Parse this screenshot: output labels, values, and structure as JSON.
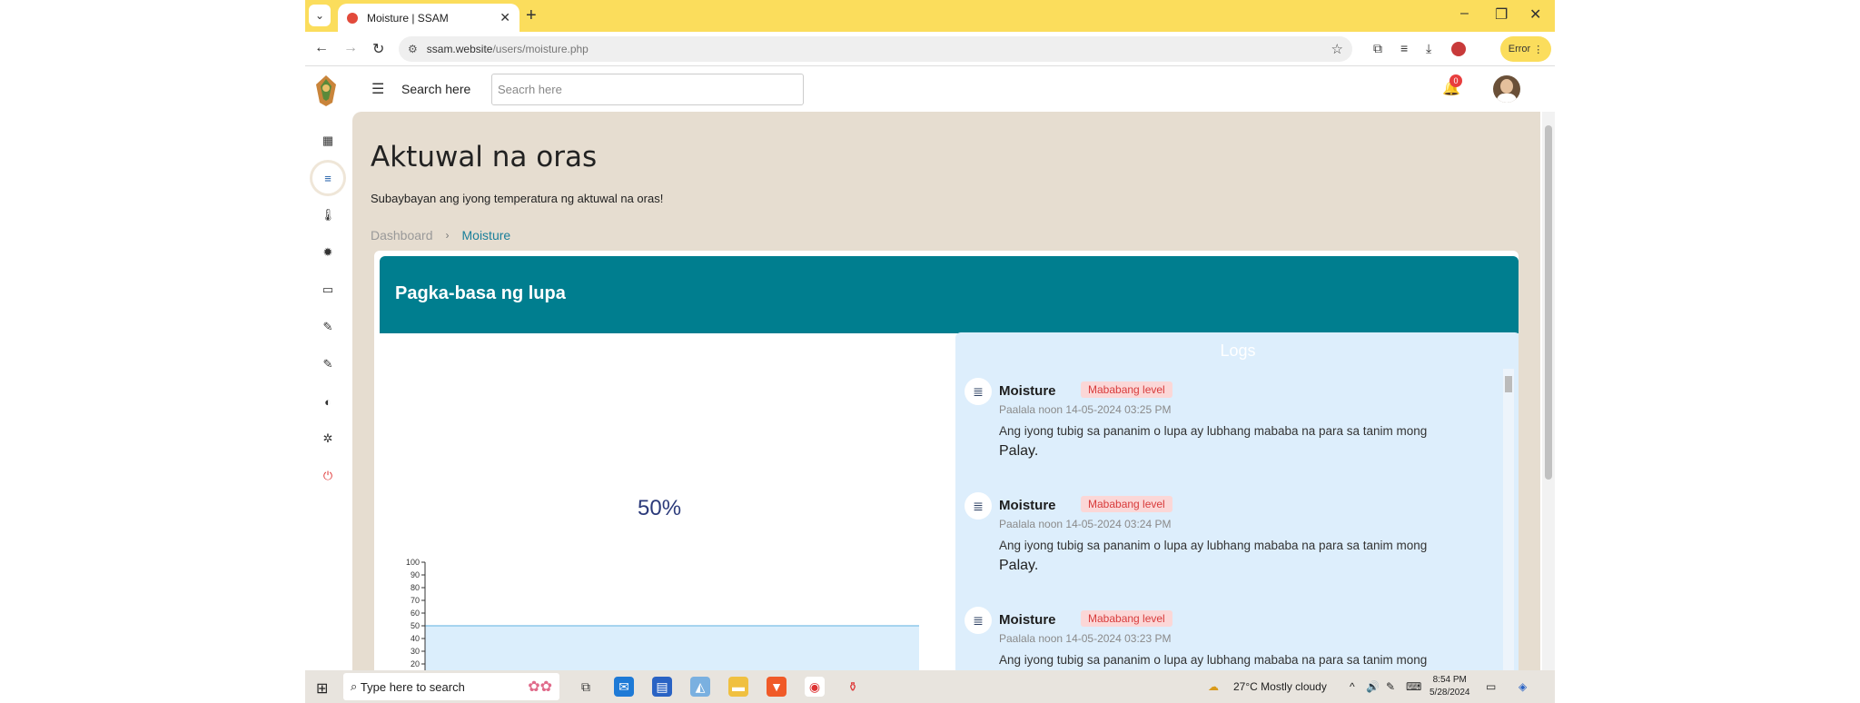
{
  "browser": {
    "tab_title": "Moisture | SSAM",
    "url_host": "ssam.website",
    "url_path": "/users/moisture.php",
    "error_label": "Error"
  },
  "header": {
    "search_label": "Search here",
    "search_placeholder": "Seacrh here",
    "notif_count": "0"
  },
  "page": {
    "title": "Aktuwal na oras",
    "subtitle": "Subaybayan ang iyong temperatura ng aktuwal na oras!",
    "breadcrumb": [
      "Dashboard",
      "Moisture"
    ]
  },
  "card": {
    "title": "Pagka-basa ng lupa",
    "gauge_value": "50%"
  },
  "chart_data": {
    "type": "area",
    "y_ticks": [
      "100",
      "90",
      "80",
      "70",
      "60",
      "50",
      "40",
      "30",
      "20"
    ],
    "ylim": [
      0,
      100
    ],
    "values": [
      50,
      50
    ],
    "colors": {
      "fill": "#dbeefc",
      "line": "#8ec9ea"
    }
  },
  "logs": {
    "title": "Logs",
    "items": [
      {
        "name": "Moisture",
        "badge": "Mababang level",
        "time": "Paalala noon 14-05-2024 03:25 PM",
        "message": "Ang iyong tubig sa pananim o lupa ay lubhang mababa na para sa tanim mong",
        "crop": "Palay."
      },
      {
        "name": "Moisture",
        "badge": "Mababang level",
        "time": "Paalala noon 14-05-2024 03:24 PM",
        "message": "Ang iyong tubig sa pananim o lupa ay lubhang mababa na para sa tanim mong",
        "crop": "Palay."
      },
      {
        "name": "Moisture",
        "badge": "Mababang level",
        "time": "Paalala noon 14-05-2024 03:23 PM",
        "message": "Ang iyong tubig sa pananim o lupa ay lubhang mababa na para sa tanim mong",
        "crop": ""
      }
    ]
  },
  "taskbar": {
    "search_text": "Type here to search",
    "weather": "27°C  Mostly cloudy",
    "time": "8:54 PM",
    "date": "5/28/2024"
  },
  "colors": {
    "accent": "#007e8f",
    "tabbar": "#fbdd5c",
    "main_bg": "#e6ddd0",
    "logs_bg": "#ddeefc",
    "badge_text": "#d83b3b"
  }
}
